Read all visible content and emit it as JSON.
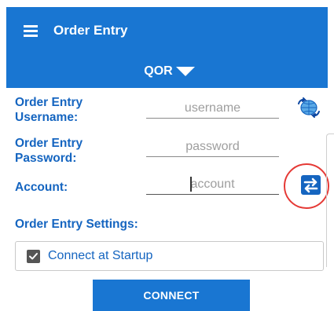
{
  "appbar": {
    "title": "Order Entry",
    "menu_icon": "hamburger-menu-icon"
  },
  "subbar": {
    "selected_server": "QOR",
    "caret_icon": "caret-down-icon"
  },
  "form": {
    "username_label": "Order Entry Username:",
    "username_placeholder": "username",
    "password_label": "Order Entry Password:",
    "password_placeholder": "password",
    "account_label": "Account:",
    "account_placeholder": "account"
  },
  "icons": {
    "globe": "globe-icon",
    "swap": "swap-arrows-icon"
  },
  "settings": {
    "heading": "Order Entry Settings:",
    "connect_at_startup_label": "Connect at Startup",
    "connect_at_startup_checked": true
  },
  "connect_button": "CONNECT",
  "colors": {
    "primary": "#1976d2",
    "label_blue": "#1565c0",
    "highlight_red": "#e53935"
  }
}
